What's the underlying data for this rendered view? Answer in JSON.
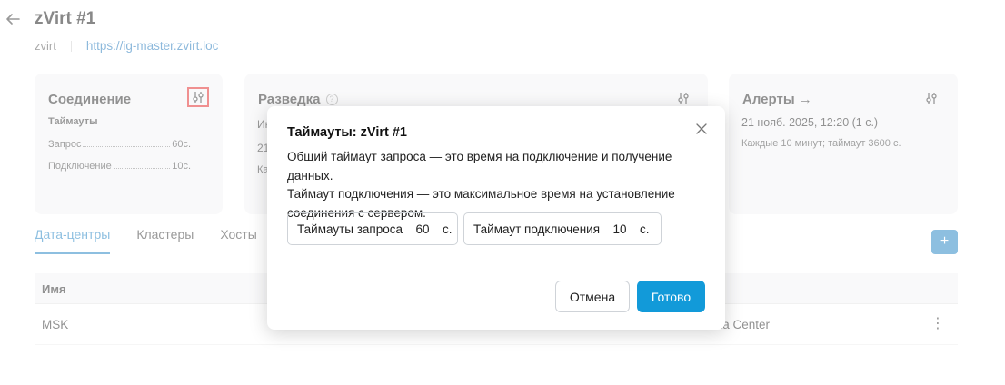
{
  "page": {
    "title": "zVirt #1",
    "type_label": "zvirt",
    "url": "https://ig-master.zvirt.loc"
  },
  "cards": {
    "connection": {
      "title": "Соединение",
      "subhead": "Таймауты",
      "rows": [
        {
          "label": "Запрос",
          "value": "60с."
        },
        {
          "label": "Подключение",
          "value": "10с."
        }
      ]
    },
    "recon": {
      "title": "Разведка",
      "fragments": [
        "Ин",
        "21",
        "Ка"
      ]
    },
    "alerts": {
      "title": "Алерты →",
      "date": "21 нояб. 2025, 12:20 (1 с.)",
      "schedule": "Каждые 10 минут; таймаут 3600 с."
    }
  },
  "tabs": [
    "Дата-центры",
    "Кластеры",
    "Хосты"
  ],
  "add_label": "+",
  "table": {
    "header": "Имя",
    "rows": [
      {
        "name": "MSK",
        "description": "ata Center"
      }
    ]
  },
  "modal": {
    "title": "Таймауты: zVirt #1",
    "description_1": "Общий таймаут запроса — это время на подключение и получение данных.",
    "description_2": "Таймаут подключения — это максимальное время на установление",
    "description_3": "соединения с сервером.",
    "request_timeout": {
      "label": "Таймауты запроса",
      "value": "60",
      "unit": "с."
    },
    "connect_timeout": {
      "label": "Таймаут подключения",
      "value": "10",
      "unit": "с."
    },
    "cancel_label": "Отмена",
    "ok_label": "Готово"
  },
  "colors": {
    "accent": "#1a7fc1",
    "primary_button": "#129ad9",
    "highlight": "#e02020"
  },
  "icons": [
    "back-arrow-icon",
    "sliders-icon",
    "help-circle-icon",
    "close-icon",
    "more-vertical-icon",
    "plus-icon"
  ]
}
